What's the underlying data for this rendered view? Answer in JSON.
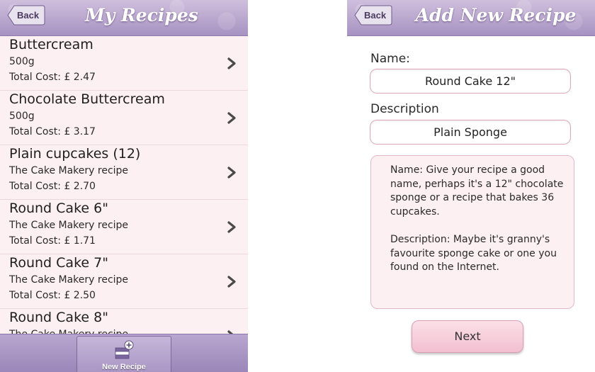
{
  "left": {
    "back_label": "Back",
    "title": "My Recipes",
    "recipes": [
      {
        "name": "Buttercream",
        "sub": "500g",
        "cost": "Total Cost: £ 2.47"
      },
      {
        "name": "Chocolate Buttercream",
        "sub": "500g",
        "cost": "Total Cost: £ 3.17"
      },
      {
        "name": "Plain cupcakes (12)",
        "sub": "The Cake Makery recipe",
        "cost": "Total Cost: £ 2.70"
      },
      {
        "name": "Round Cake 6\"",
        "sub": "The Cake Makery recipe",
        "cost": "Total Cost: £ 1.71"
      },
      {
        "name": "Round Cake 7\"",
        "sub": "The Cake Makery recipe",
        "cost": "Total Cost: £ 2.50"
      },
      {
        "name": "Round Cake 8\"",
        "sub": "The Cake Makery recipe",
        "cost": ""
      }
    ],
    "tab_label": "New Recipe",
    "tab_icon": "cake-plus-icon"
  },
  "right": {
    "back_label": "Back",
    "title": "Add New Recipe",
    "name_label": "Name:",
    "name_value": "Round Cake 12\"",
    "description_label": "Description",
    "description_value": "Plain Sponge",
    "help_name": "Name: Give your recipe a good name, perhaps it's a 12\" chocolate sponge or a recipe that bakes 36 cupcakes.",
    "help_description": "Description: Maybe it's granny's favourite sponge cake or one you found on the Internet.",
    "next_label": "Next"
  },
  "colors": {
    "navbar": "#a792c2",
    "list_background": "#fdf0f3",
    "row_divider": "#ead8de",
    "field_border": "#d9a9bb",
    "next_button": "#f3bfd0"
  }
}
